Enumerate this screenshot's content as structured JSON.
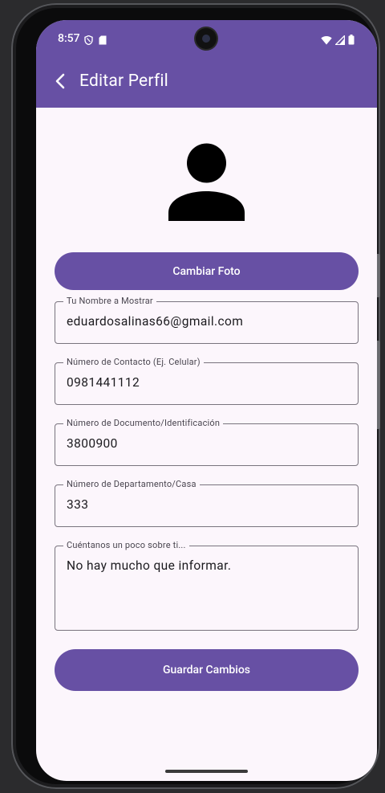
{
  "status_bar": {
    "time": "8:57",
    "icons_left": [
      "shield-icon",
      "sd-card-icon"
    ],
    "icons_right": [
      "wifi-icon",
      "signal-icon",
      "battery-icon"
    ]
  },
  "app_bar": {
    "back_icon": "arrow-back-icon",
    "title": "Editar Perfil"
  },
  "avatar": {
    "icon": "person-icon"
  },
  "buttons": {
    "change_photo": "Cambiar Foto",
    "save": "Guardar Cambios"
  },
  "form": {
    "fields": [
      {
        "label": "Tu Nombre a Mostrar",
        "value": "eduardosalinas66@gmail.com"
      },
      {
        "label": "Número de Contacto (Ej. Celular)",
        "value": "0981441112"
      },
      {
        "label": "Número de Documento/Identificación",
        "value": "3800900"
      },
      {
        "label": "Número de Departamento/Casa",
        "value": "333"
      },
      {
        "label": "Cuéntanos un poco sobre ti...",
        "value": "No hay mucho que informar."
      }
    ]
  },
  "colors": {
    "primary": "#6750a4",
    "background": "#fcf6fc",
    "outline": "#79747e",
    "on_surface": "#1c1b1f"
  }
}
